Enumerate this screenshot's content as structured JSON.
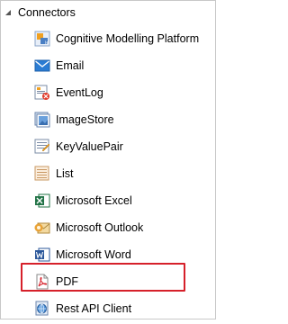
{
  "tree": {
    "header": {
      "label": "Connectors",
      "icon": "collapse-arrow-icon"
    },
    "items": [
      {
        "label": "Cognitive Modelling Platform",
        "icon": "cognitive-modelling-icon"
      },
      {
        "label": "Email",
        "icon": "email-icon"
      },
      {
        "label": "EventLog",
        "icon": "eventlog-icon"
      },
      {
        "label": "ImageStore",
        "icon": "imagestore-icon"
      },
      {
        "label": "KeyValuePair",
        "icon": "keyvaluepair-icon"
      },
      {
        "label": "List",
        "icon": "list-icon"
      },
      {
        "label": "Microsoft Excel",
        "icon": "excel-icon"
      },
      {
        "label": "Microsoft Outlook",
        "icon": "outlook-icon"
      },
      {
        "label": "Microsoft Word",
        "icon": "word-icon"
      },
      {
        "label": "PDF",
        "icon": "pdf-icon"
      },
      {
        "label": "Rest API Client",
        "icon": "rest-api-icon"
      }
    ]
  },
  "colors": {
    "highlight_border": "#d6202a",
    "frame_border": "#c8c8c8"
  }
}
